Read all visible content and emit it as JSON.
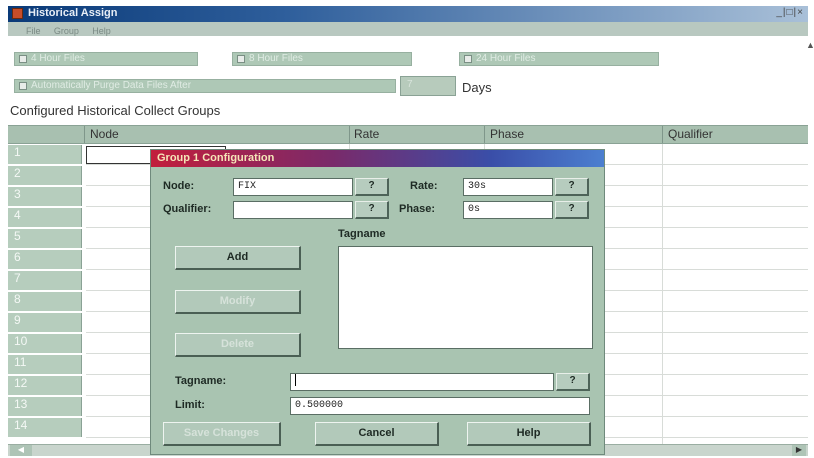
{
  "window": {
    "title": "Historical Assign",
    "controls": "_|□|×",
    "menu": [
      "File",
      "Group",
      "Help"
    ]
  },
  "options": {
    "files_8hour": "4 Hour Files",
    "files_4hour": "8 Hour Files",
    "files_24hour": "24 Hour Files",
    "auto_purge": "Automatically Purge Data Files After",
    "days_value": "7",
    "days_label": "Days"
  },
  "groups_label": "Configured Historical Collect Groups",
  "grid": {
    "columns": [
      "Node",
      "Rate",
      "Phase",
      "Qualifier"
    ],
    "row_numbers": [
      "1",
      "2",
      "3",
      "4",
      "5",
      "6",
      "7",
      "8",
      "9",
      "10",
      "11",
      "12",
      "13",
      "14"
    ]
  },
  "dialog": {
    "title": "Group 1 Configuration",
    "node_label": "Node:",
    "node_value": "FIX",
    "rate_label": "Rate:",
    "rate_value": "30s",
    "qualifier_label": "Qualifier:",
    "qualifier_value": "",
    "phase_label": "Phase:",
    "phase_value": "0s",
    "browse_label": "?",
    "tagname_list_label": "Tagname",
    "add_label": "Add",
    "modify_label": "Modify",
    "delete_label": "Delete",
    "tagname_label": "Tagname:",
    "tagname_value": "",
    "limit_label": "Limit:",
    "limit_value": "0.500000",
    "save_label": "Save Changes",
    "cancel_label": "Cancel",
    "help_label": "Help"
  },
  "colors": {
    "accent_panel": "#a9c4b1",
    "dialog_title_start": "#c21e3c",
    "dialog_title_end": "#4c7fd0"
  }
}
